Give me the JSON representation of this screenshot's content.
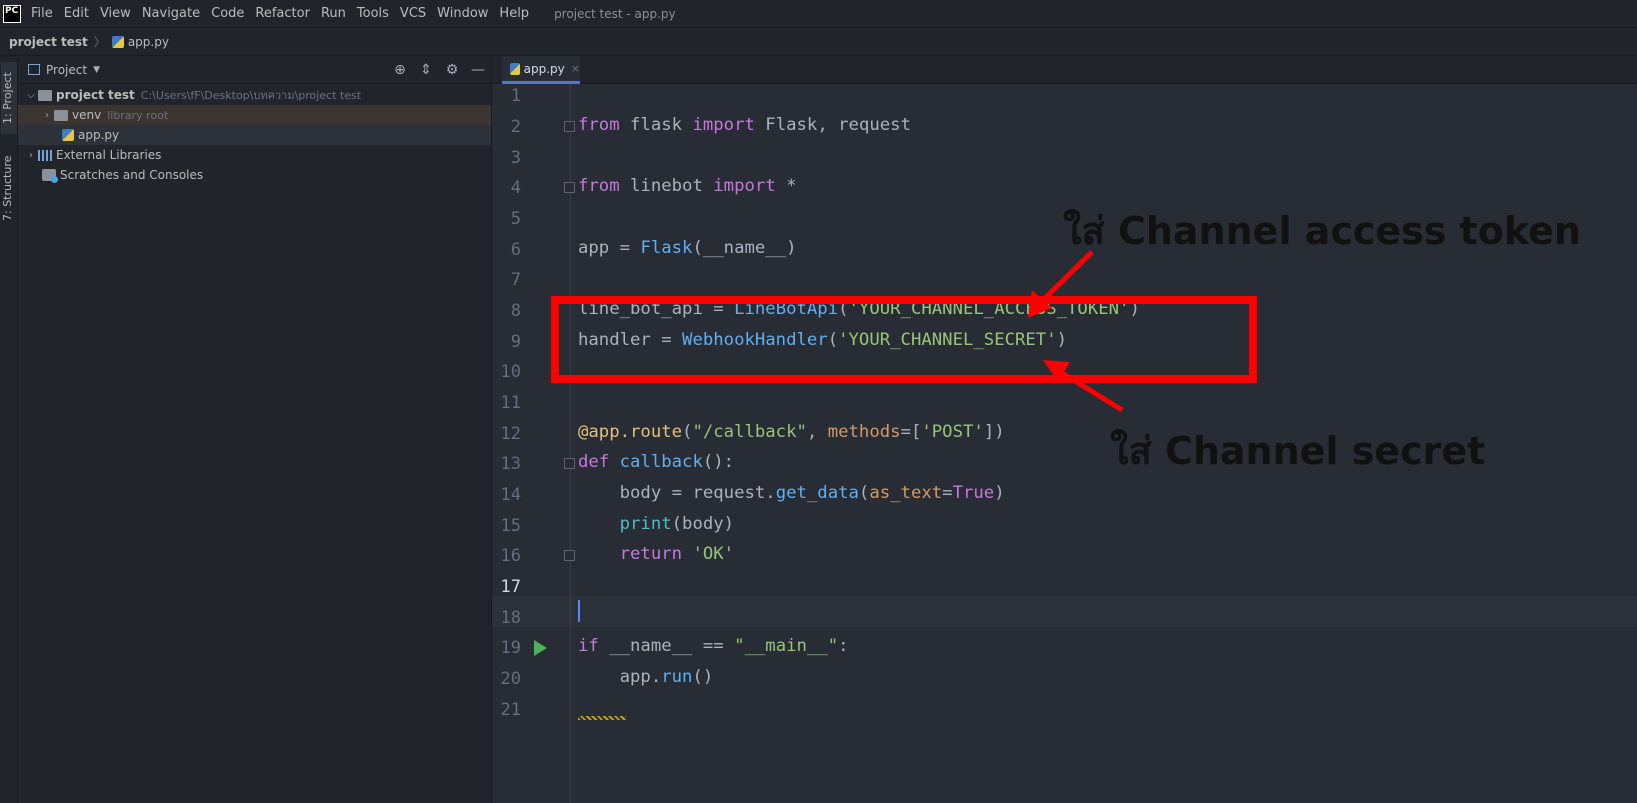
{
  "menubar": {
    "logo": "PC",
    "items": [
      "File",
      "Edit",
      "View",
      "Navigate",
      "Code",
      "Refactor",
      "Run",
      "Tools",
      "VCS",
      "Window",
      "Help"
    ],
    "window_title": "project test - app.py"
  },
  "breadcrumb": {
    "project": "project test",
    "file": "app.py"
  },
  "toolstrip": {
    "project_tab": "1: Project",
    "structure_tab": "7: Structure"
  },
  "project_panel": {
    "title": "Project",
    "tree": {
      "root_name": "project test",
      "root_path": "C:\\Users\\fF\\Desktop\\บทความ\\project test",
      "venv_name": "venv",
      "venv_hint": "library root",
      "file_name": "app.py",
      "external_libraries": "External Libraries",
      "scratches": "Scratches and Consoles"
    }
  },
  "editor": {
    "tab_label": "app.py",
    "line_numbers": [
      "1",
      "2",
      "3",
      "4",
      "5",
      "6",
      "7",
      "8",
      "9",
      "10",
      "11",
      "12",
      "13",
      "14",
      "15",
      "16",
      "17",
      "18",
      "19",
      "20",
      "21"
    ],
    "current_line": 17,
    "code": {
      "l2": {
        "k1": "from",
        "a": " flask ",
        "k2": "import",
        "b": " Flask, request"
      },
      "l4": {
        "k1": "from",
        "a": " linebot ",
        "k2": "import",
        "b": " *"
      },
      "l6": {
        "a": "app = ",
        "fn": "Flask",
        "b": "(__name__)"
      },
      "l8": {
        "a": "line_bot_api = ",
        "fn": "LineBotApi",
        "b": "(",
        "s": "'YOUR_CHANNEL_ACCESS_TOKEN'",
        "c": ")"
      },
      "l9": {
        "a": "handler = ",
        "fn": "WebhookHandler",
        "b": "(",
        "s": "'YOUR_CHANNEL_SECRET'",
        "c": ")"
      },
      "l12": {
        "dec": "@app.route",
        "a": "(",
        "s": "\"/callback\"",
        "b": ", ",
        "p": "methods",
        "c": "=[",
        "s2": "'POST'",
        "d": "])"
      },
      "l13": {
        "k": "def",
        "a": " ",
        "fn": "callback",
        "b": "():"
      },
      "l14": {
        "a": "    body = request.",
        "fn": "get_data",
        "b": "(",
        "p": "as_text",
        "c": "=",
        "k": "True",
        "d": ")"
      },
      "l15": {
        "a": "    ",
        "blt": "print",
        "b": "(body)"
      },
      "l16": {
        "a": "    ",
        "k": "return",
        "b": " ",
        "s": "'OK'"
      },
      "l19": {
        "k": "if",
        "a": " __name__ == ",
        "s": "\"__main__\"",
        "b": ":"
      },
      "l20": {
        "a": "    app.",
        "fn": "run",
        "b": "()"
      }
    }
  },
  "annotations": {
    "token_label": "ใส่ Channel access token",
    "secret_label": "ใส่ Channel secret",
    "box_color": "#ff0000"
  }
}
